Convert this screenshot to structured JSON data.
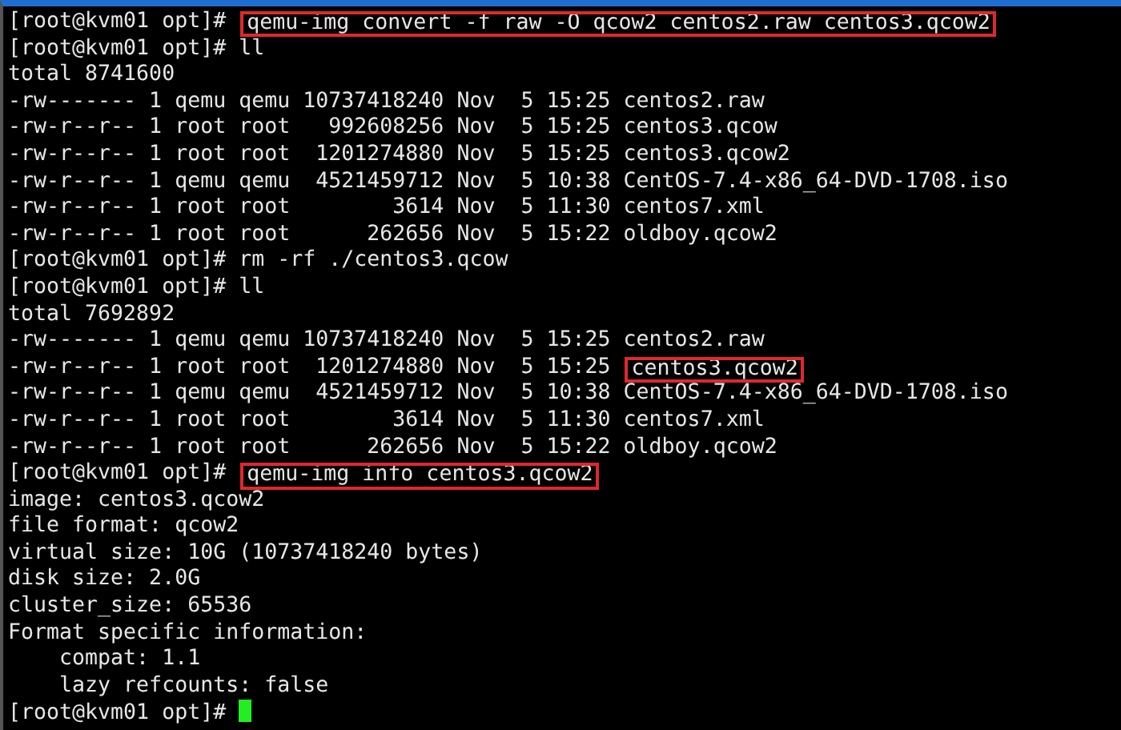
{
  "lines": [
    {
      "kind": "command",
      "prompt": "[root@kvm01 opt]#",
      "command": "qemu-img convert -f raw -O qcow2 centos2.raw centos3.qcow2",
      "highlighted": true,
      "cursor": false
    },
    {
      "kind": "command",
      "prompt": "[root@kvm01 opt]#",
      "command": "ll",
      "highlighted": false,
      "cursor": false
    },
    {
      "kind": "output",
      "text": "total 8741600"
    },
    {
      "kind": "listing",
      "details": "-rw------- 1 qemu qemu 10737418240 Nov  5 15:25",
      "name": "centos2.raw",
      "highlighted": false
    },
    {
      "kind": "listing",
      "details": "-rw-r--r-- 1 root root   992608256 Nov  5 15:25",
      "name": "centos3.qcow",
      "highlighted": false
    },
    {
      "kind": "listing",
      "details": "-rw-r--r-- 1 root root  1201274880 Nov  5 15:25",
      "name": "centos3.qcow2",
      "highlighted": false
    },
    {
      "kind": "listing",
      "details": "-rw-r--r-- 1 qemu qemu  4521459712 Nov  5 10:38",
      "name": "CentOS-7.4-x86_64-DVD-1708.iso",
      "highlighted": false
    },
    {
      "kind": "listing",
      "details": "-rw-r--r-- 1 root root        3614 Nov  5 11:30",
      "name": "centos7.xml",
      "highlighted": false
    },
    {
      "kind": "listing",
      "details": "-rw-r--r-- 1 root root      262656 Nov  5 15:22",
      "name": "oldboy.qcow2",
      "highlighted": false
    },
    {
      "kind": "command",
      "prompt": "[root@kvm01 opt]#",
      "command": "rm -rf ./centos3.qcow",
      "highlighted": false,
      "cursor": false
    },
    {
      "kind": "command",
      "prompt": "[root@kvm01 opt]#",
      "command": "ll",
      "highlighted": false,
      "cursor": false
    },
    {
      "kind": "output",
      "text": "total 7692892"
    },
    {
      "kind": "listing",
      "details": "-rw------- 1 qemu qemu 10737418240 Nov  5 15:25",
      "name": "centos2.raw",
      "highlighted": false
    },
    {
      "kind": "listing",
      "details": "-rw-r--r-- 1 root root  1201274880 Nov  5 15:25",
      "name": "centos3.qcow2",
      "highlighted": true
    },
    {
      "kind": "listing",
      "details": "-rw-r--r-- 1 qemu qemu  4521459712 Nov  5 10:38",
      "name": "CentOS-7.4-x86_64-DVD-1708.iso",
      "highlighted": false
    },
    {
      "kind": "listing",
      "details": "-rw-r--r-- 1 root root        3614 Nov  5 11:30",
      "name": "centos7.xml",
      "highlighted": false
    },
    {
      "kind": "listing",
      "details": "-rw-r--r-- 1 root root      262656 Nov  5 15:22",
      "name": "oldboy.qcow2",
      "highlighted": false
    },
    {
      "kind": "command",
      "prompt": "[root@kvm01 opt]#",
      "command": "qemu-img info centos3.qcow2",
      "highlighted": true,
      "cursor": false
    },
    {
      "kind": "output",
      "text": "image: centos3.qcow2"
    },
    {
      "kind": "output",
      "text": "file format: qcow2"
    },
    {
      "kind": "output",
      "text": "virtual size: 10G (10737418240 bytes)"
    },
    {
      "kind": "output",
      "text": "disk size: 2.0G"
    },
    {
      "kind": "output",
      "text": "cluster_size: 65536"
    },
    {
      "kind": "output",
      "text": "Format specific information:"
    },
    {
      "kind": "output",
      "text": "    compat: 1.1"
    },
    {
      "kind": "output",
      "text": "    lazy refcounts: false"
    },
    {
      "kind": "command",
      "prompt": "[root@kvm01 opt]#",
      "highlighted": false,
      "cursor": true
    }
  ]
}
